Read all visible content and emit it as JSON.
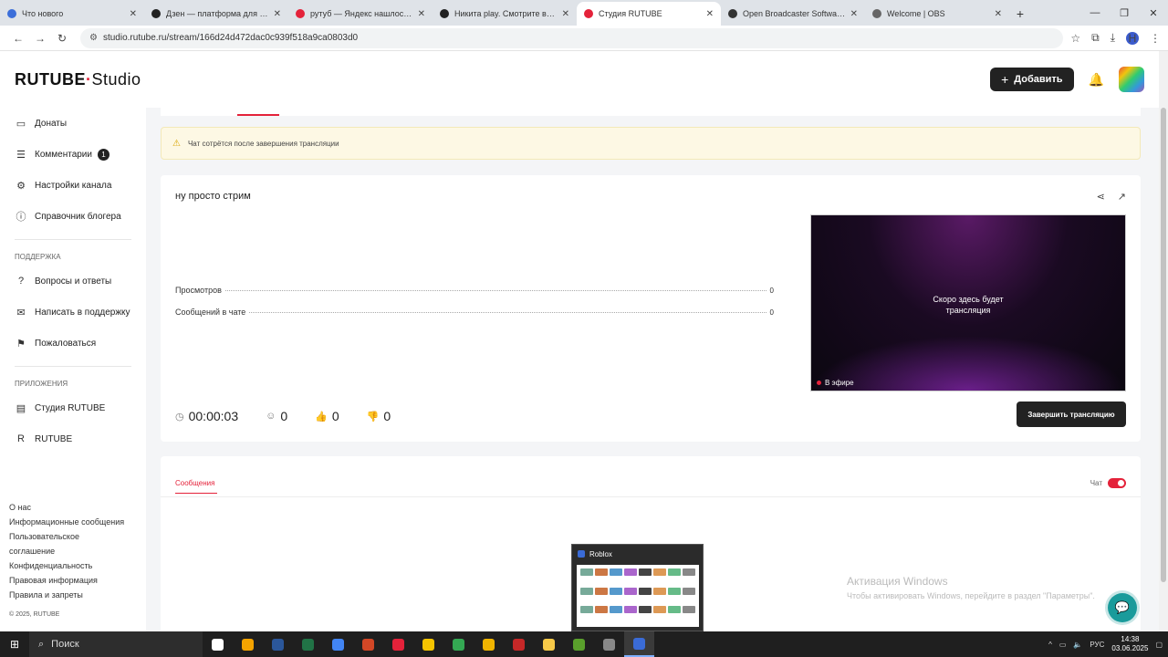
{
  "browser": {
    "tabs": [
      {
        "title": "Что нового",
        "color": "#3b6ed9",
        "active": false
      },
      {
        "title": "Дзен — платформа для прос",
        "color": "#222222",
        "active": false
      },
      {
        "title": "рутуб — Яндекс нашлось 3 м",
        "color": "#e4223a",
        "active": false
      },
      {
        "title": "Никита play. Смотрите видео",
        "color": "#222222",
        "active": false
      },
      {
        "title": "Студия RUTUBE",
        "color": "#e4223a",
        "active": true
      },
      {
        "title": "Open Broadcaster Software | O",
        "color": "#333333",
        "active": false
      },
      {
        "title": "Welcome | OBS",
        "color": "#666666",
        "active": false
      }
    ],
    "url": "studio.rutube.ru/stream/166d24d472dac0c939f518a9ca0803d0",
    "profile_initial": "Н"
  },
  "header": {
    "logo_main": "RUTUBE",
    "logo_studio": "Studio",
    "add_label": "Добавить"
  },
  "sidebar": {
    "items": [
      {
        "label": "Донаты",
        "icon": "wallet-icon"
      },
      {
        "label": "Комментарии",
        "icon": "comment-icon",
        "badge": "1"
      },
      {
        "label": "Настройки канала",
        "icon": "gear-icon"
      },
      {
        "label": "Справочник блогера",
        "icon": "info-icon"
      }
    ],
    "support_heading": "ПОДДЕРЖКА",
    "support_items": [
      {
        "label": "Вопросы и ответы",
        "icon": "question-icon"
      },
      {
        "label": "Написать в поддержку",
        "icon": "mail-icon"
      },
      {
        "label": "Пожаловаться",
        "icon": "flag-icon"
      }
    ],
    "apps_heading": "ПРИЛОЖЕНИЯ",
    "apps_items": [
      {
        "label": "Студия RUTUBE",
        "icon": "studio-app-icon"
      },
      {
        "label": "RUTUBE",
        "icon": "rutube-app-icon"
      }
    ],
    "footer_links": [
      "О нас",
      "Информационные сообщения",
      "Пользовательское",
      "соглашение",
      "Конфиденциальность",
      "Правовая информация",
      "Правила и запреты"
    ],
    "copyright": "© 2025, RUTUBE"
  },
  "warning": {
    "text": "Чат сотрётся после завершения трансляции"
  },
  "stream": {
    "title": "ну просто стрим",
    "stats": [
      {
        "label": "Просмотров",
        "value": "0"
      },
      {
        "label": "Сообщений в чате",
        "value": "0"
      }
    ],
    "player_text_1": "Скоро здесь будет",
    "player_text_2": "трансляция",
    "on_air": "В эфире",
    "duration": "00:00:03",
    "viewers": "0",
    "likes": "0",
    "dislikes": "0",
    "end_button": "Завершить трансляцию"
  },
  "chat": {
    "tab_label": "Сообщения",
    "toggle_label": "Чат"
  },
  "watermark": {
    "line1": "Активация Windows",
    "line2": "Чтобы активировать Windows, перейдите в раздел \"Параметры\"."
  },
  "taskbar": {
    "search_label": "Поиск",
    "thumbnail_title": "Roblox",
    "lang": "РУС",
    "time": "14:38",
    "date": "03.06.2025",
    "app_colors": [
      "#ffffff",
      "#f4a300",
      "#2b579a",
      "#217346",
      "#4285f4",
      "#d24726",
      "#e4223a",
      "#f5c400",
      "#34a853",
      "#f0b400",
      "#c62828",
      "#f7c948",
      "#5aa02c",
      "#888888",
      "#3a6bd6"
    ]
  }
}
